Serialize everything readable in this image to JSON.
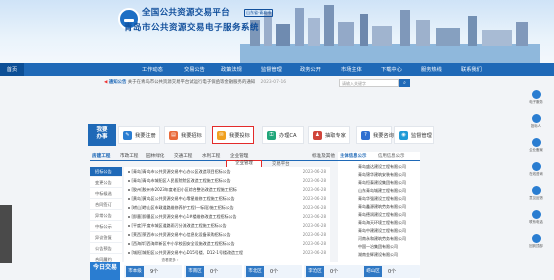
{
  "header": {
    "title_line1": "全国公共资源交易平台",
    "title_badge": "山东省·青岛市",
    "title_line2": "青岛市公共资源交易电子服务系统"
  },
  "nav": {
    "items": [
      "首页",
      "工作动态",
      "交易公告",
      "政策法规",
      "监督管理",
      "政务公开",
      "市场主体",
      "下载中心",
      "服务热线",
      "联系我们"
    ]
  },
  "notice": {
    "label": "通知公告",
    "text": "关于在青岛市公共资源交易平台试运行电子保函等金融服务的通知",
    "date": "2023-07-16",
    "search_placeholder": "请输入关键字"
  },
  "services": {
    "block_label_1": "我要",
    "block_label_2": "办事",
    "items": [
      "我要注册",
      "我要招标",
      "我要投标",
      "办理CA",
      "抽取专家",
      "我要咨询",
      "监督管理"
    ]
  },
  "tabs": {
    "items": [
      "房建工程",
      "市政工程",
      "园林绿化",
      "交通工程",
      "水利工程",
      "企业管理",
      "标准及其他"
    ]
  },
  "subtabs": {
    "active": "企业管理",
    "other": "交易平台"
  },
  "side": {
    "items": [
      "招标公告",
      "变更公告",
      "中标候选",
      "合同签订",
      "异常公告",
      "中标公示",
      "异议答复",
      "公告预告",
      "合同履约"
    ]
  },
  "list": {
    "items": [
      {
        "text": "[青岛]青岛市公共资源交易中心办公区改造项目招标公告",
        "date": "2023-06-28"
      },
      {
        "text": "[青岛]青岛市城阳区人民医院院区改造工程施工招标公告",
        "date": "2023-06-28"
      },
      {
        "text": "[胶州]胶州市2023年度老旧小区综合整治改造工程施工招标",
        "date": "2023-06-28"
      },
      {
        "text": "[黄岛]黄岛区公共资源交易中心零星维修工程施工招标公告",
        "date": "2023-06-28"
      },
      {
        "text": "[崂山]崂山区市政道路维修养护工程(一标段)施工招标公告",
        "date": "2023-06-28"
      },
      {
        "text": "[即墨]即墨区公共资源交易中心1#楼维修改造工程招标公告",
        "date": "2023-06-28"
      },
      {
        "text": "[平度]平度市城区道路雨污分流改造工程施工招标公告",
        "date": "2023-06-28"
      },
      {
        "text": "[莱西]莱西市公共资源交易中心信息化设备采购招标公告",
        "date": "2023-06-28"
      },
      {
        "text": "[西海岸]西海岸新区中小学校园安全设施改造工程招标公告",
        "date": "2023-06-28"
      },
      {
        "text": "[城阳]城阳区公共资源交易中心D15号楼、D12-1号楼改造工程",
        "date": "2023-06-28"
      }
    ],
    "more": "查看更多 ›"
  },
  "right": {
    "tabs": [
      "主体信息公示",
      "信用信息公示"
    ],
    "items": [
      "青岛盛达建设工程有限公司",
      "青岛锦华建筑安装有限公司",
      "青岛恒泰建设集团有限公司",
      "山东青岛城建工程有限公司",
      "青岛华强建设工程有限公司",
      "青岛鑫源建筑劳务有限公司",
      "青岛德润建设工程有限公司",
      "青岛海天环境工程有限公司",
      "青岛中建建设工程有限公司",
      "河南永和建筑劳务有限公司",
      "中国一冶集团有限公司",
      "湖南金辉建设有限公司"
    ]
  },
  "stats": {
    "today": "今日交易",
    "items": [
      {
        "k": "市本级",
        "v": "9个"
      },
      {
        "k": "市南区",
        "v": "0个"
      },
      {
        "k": "市北区",
        "v": "0个"
      },
      {
        "k": "李沧区",
        "v": "0个"
      },
      {
        "k": "崂山区",
        "v": "0个"
      }
    ]
  },
  "rside": {
    "items": [
      "电子服务",
      "投标人",
      "企业备案",
      "在线咨询",
      "意见反馈",
      "联系电话",
      "回到顶部"
    ]
  }
}
